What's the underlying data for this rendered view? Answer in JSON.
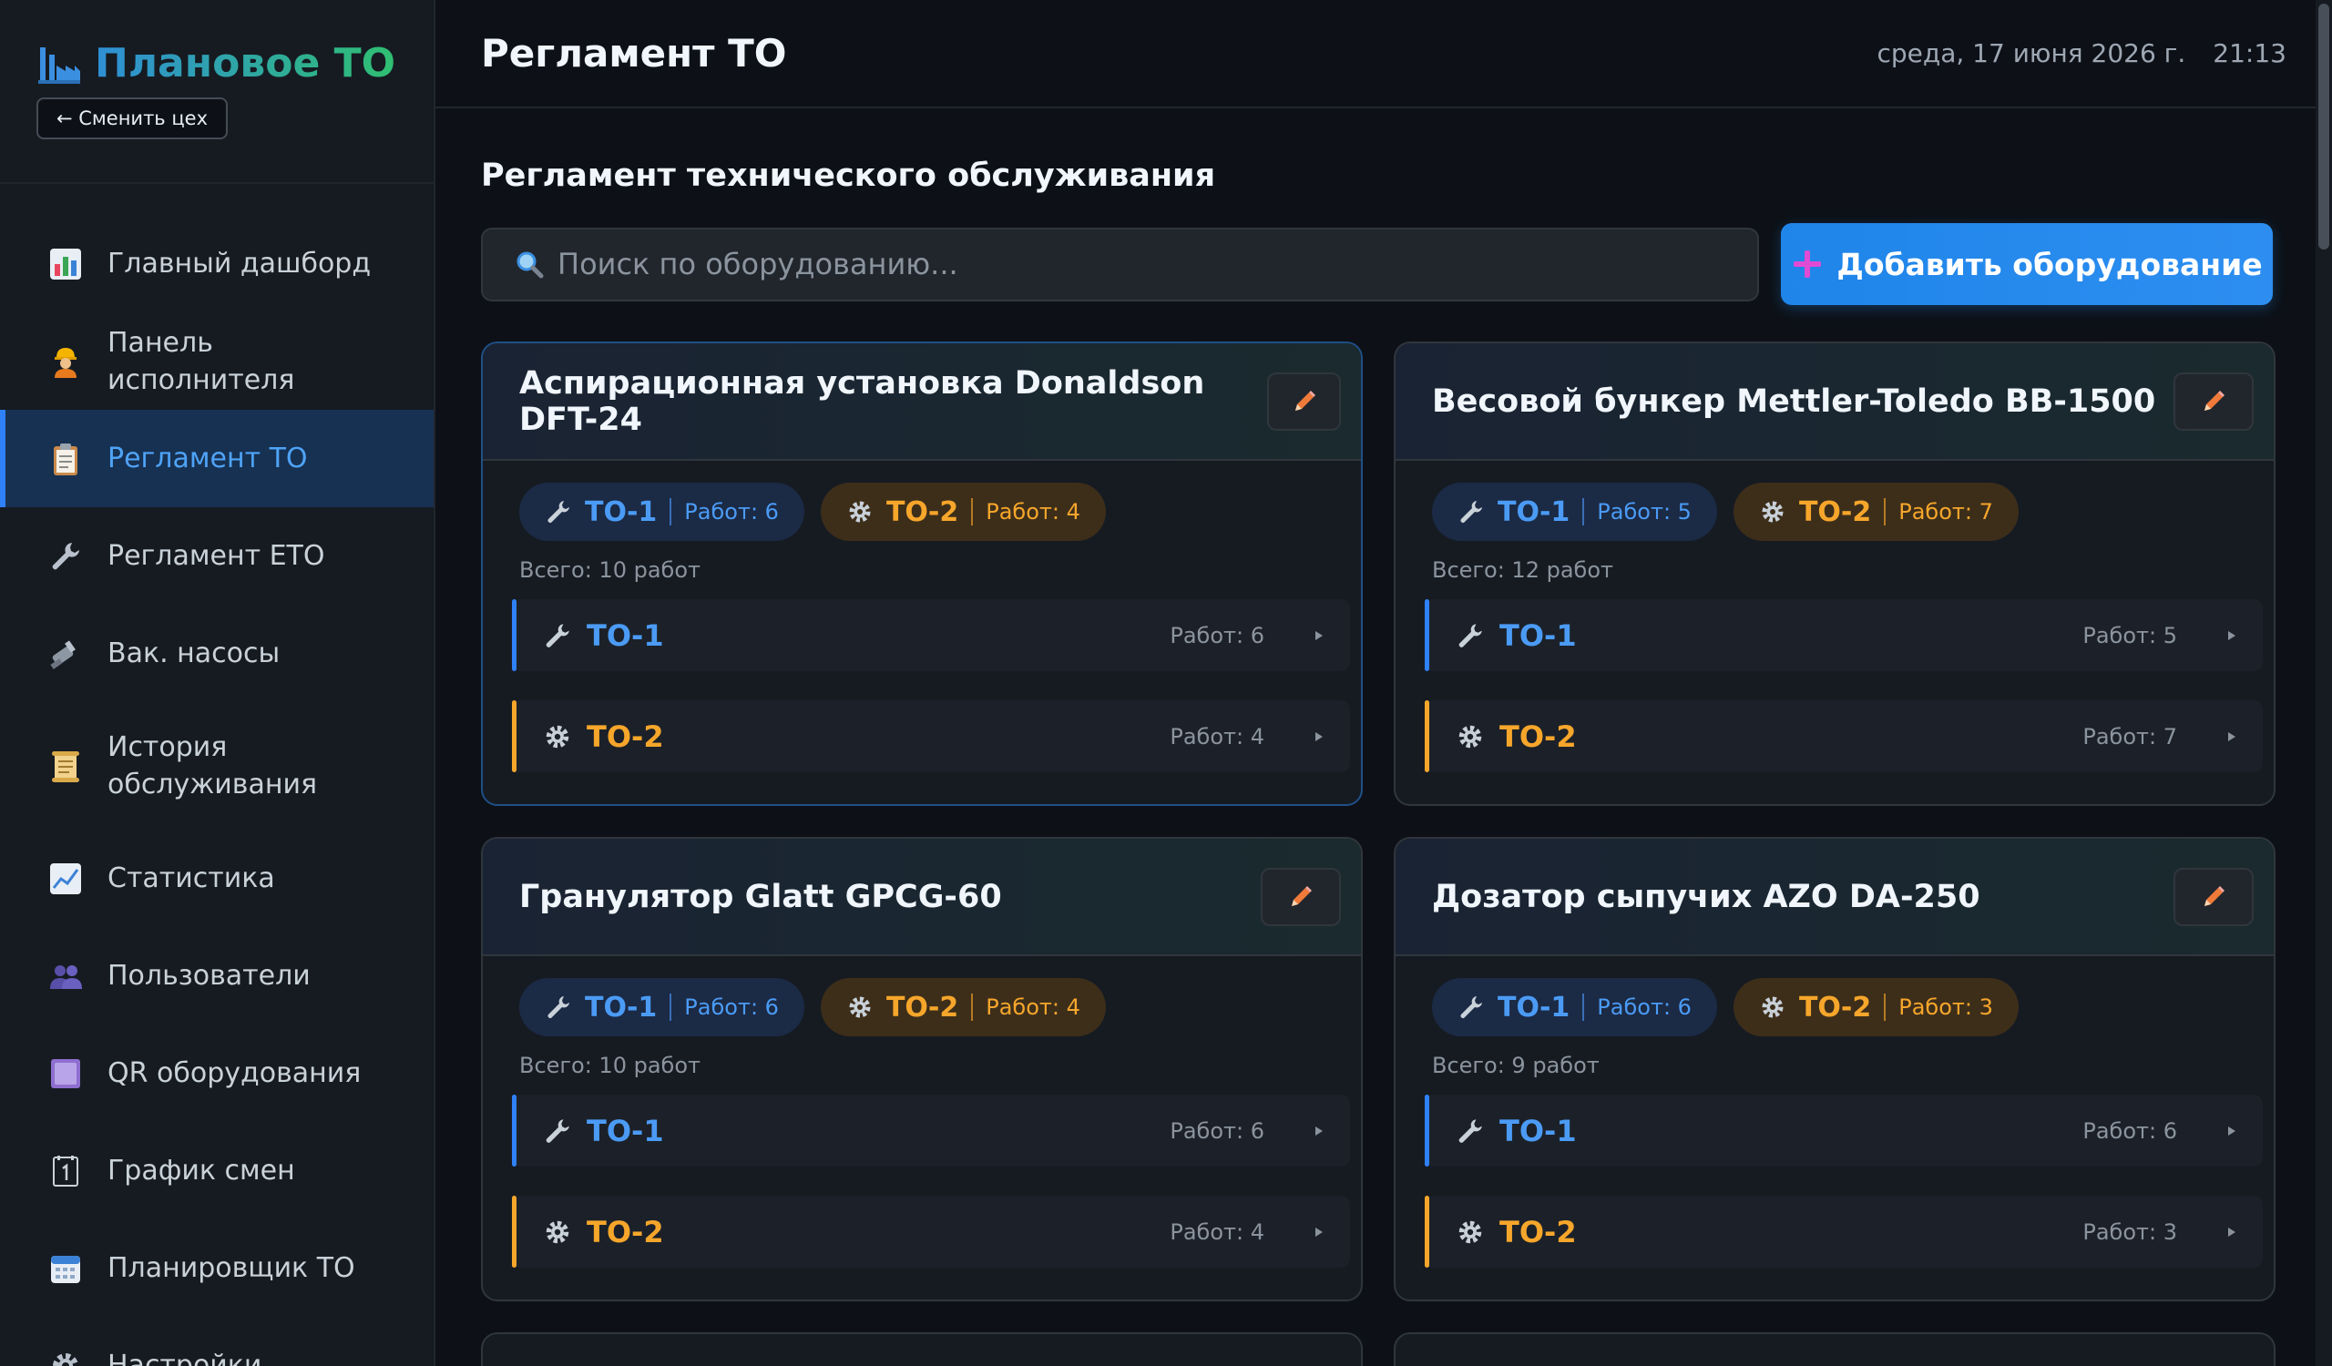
{
  "sidebar": {
    "brand_title": "Плановое ТО",
    "change_button": "← Сменить цех",
    "items": [
      {
        "label": "Главный дашборд",
        "icon": "chart-bar-icon"
      },
      {
        "label": "Панель исполнителя",
        "icon": "worker-icon"
      },
      {
        "label": "Регламент ТО",
        "icon": "clipboard-icon",
        "active": true
      },
      {
        "label": "Регламент ЕТО",
        "icon": "wrench-icon"
      },
      {
        "label": "Вак. насосы",
        "icon": "pump-icon"
      },
      {
        "label": "История обслуживания",
        "icon": "scroll-icon"
      },
      {
        "label": "Статистика",
        "icon": "chart-line-icon"
      },
      {
        "label": "Пользователи",
        "icon": "users-icon"
      },
      {
        "label": "QR оборудования",
        "icon": "qr-icon"
      },
      {
        "label": "График смен",
        "icon": "calendar-one-icon"
      },
      {
        "label": "Планировщик ТО",
        "icon": "calendar-icon"
      },
      {
        "label": "Настройки",
        "icon": "gear-icon"
      }
    ]
  },
  "header": {
    "title": "Регламент ТО",
    "date": "среда, 17 июня 2026 г.",
    "time": "21:13"
  },
  "main": {
    "section_title": "Регламент технического обслуживания",
    "search_placeholder": "Поиск по оборудованию...",
    "add_button": "Добавить оборудование",
    "cards": [
      {
        "title": "Аспирационная установка Donaldson DFT-24",
        "to1_label": "ТО-1",
        "to1_count": "Работ: 6",
        "to2_label": "ТО-2",
        "to2_count": "Работ: 4",
        "total": "Всего: 10 работ"
      },
      {
        "title": "Весовой бункер Mettler-Toledo BB-1500",
        "to1_label": "ТО-1",
        "to1_count": "Работ: 5",
        "to2_label": "ТО-2",
        "to2_count": "Работ: 7",
        "total": "Всего: 12 работ"
      },
      {
        "title": "Гранулятор Glatt GPCG-60",
        "to1_label": "ТО-1",
        "to1_count": "Работ: 6",
        "to2_label": "ТО-2",
        "to2_count": "Работ: 4",
        "total": "Всего: 10 работ"
      },
      {
        "title": "Дозатор сыпучих AZO DA-250",
        "to1_label": "ТО-1",
        "to1_count": "Работ: 6",
        "to2_label": "ТО-2",
        "to2_count": "Работ: 3",
        "total": "Всего: 9 работ"
      }
    ]
  },
  "colors": {
    "accent_blue": "#2f81f7",
    "accent_orange": "#f6a62b",
    "background": "#0d1117",
    "panel": "#161b22"
  }
}
